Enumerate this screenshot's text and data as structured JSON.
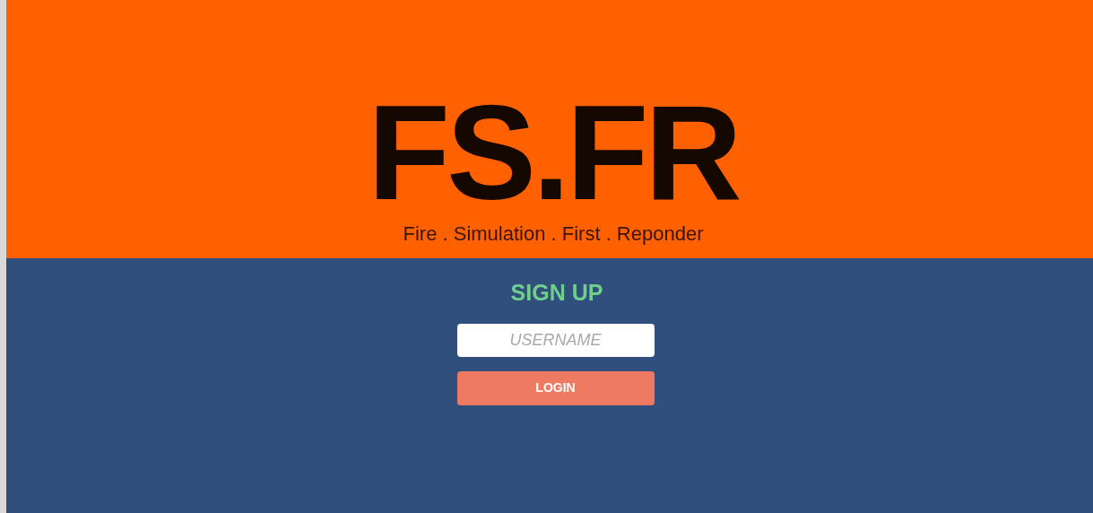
{
  "logo": {
    "title": "FS.FR",
    "tagline": "Fire . Simulation . First . Reponder"
  },
  "form": {
    "heading": "SIGN UP",
    "username": {
      "placeholder": "USERNAME"
    },
    "button": "LOGIN"
  }
}
